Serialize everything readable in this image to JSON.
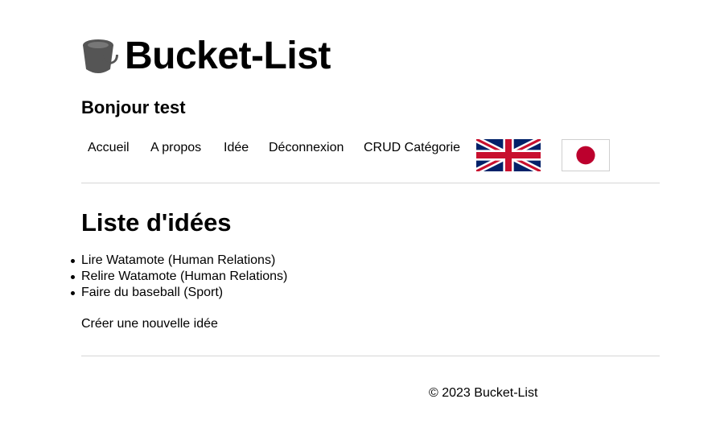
{
  "header": {
    "brand_icon": "bucket-icon",
    "brand_title": "Bucket-List",
    "greeting": "Bonjour test"
  },
  "nav": {
    "items": [
      {
        "label": "Accueil"
      },
      {
        "label": "A propos"
      },
      {
        "label": "Idée"
      },
      {
        "label": "Déconnexion"
      },
      {
        "label": "CRUD Catégorie"
      }
    ],
    "flags": [
      {
        "icon": "uk-flag-icon",
        "colors": {
          "blue": "#012169",
          "red": "#C8102E",
          "white": "#ffffff"
        }
      },
      {
        "icon": "japan-flag-icon",
        "colors": {
          "red": "#BC002D",
          "white": "#ffffff"
        }
      }
    ]
  },
  "main": {
    "title": "Liste d'idées",
    "ideas": [
      {
        "text": "Lire Watamote (Human Relations)"
      },
      {
        "text": "Relire Watamote (Human Relations)"
      },
      {
        "text": "Faire du baseball (Sport)"
      }
    ],
    "create_link": "Créer une nouvelle idée"
  },
  "footer": {
    "text": "© 2023 Bucket-List"
  },
  "colors": {
    "text": "#000000",
    "divider": "#d6d6d6",
    "icon": "#555555"
  }
}
